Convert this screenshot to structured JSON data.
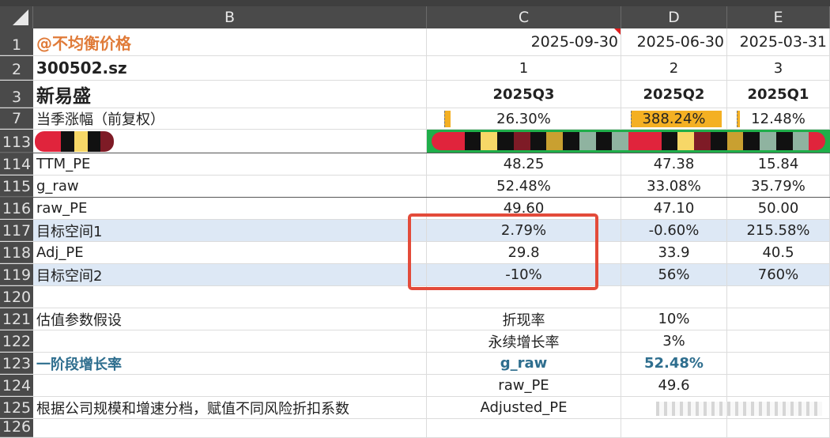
{
  "columns": {
    "b": "B",
    "c": "C",
    "d": "D",
    "e": "E"
  },
  "rows": [
    {
      "num": "1",
      "b": "@不均衡价格",
      "c": "2025-09-30",
      "d": "2025-06-30",
      "e": "2025-03-31"
    },
    {
      "num": "2",
      "b": "300502.sz",
      "c": "1",
      "d": "2",
      "e": "3"
    },
    {
      "num": "3",
      "b": "新易盛",
      "c": "2025Q3",
      "d": "2025Q2",
      "e": "2025Q1"
    },
    {
      "num": "7",
      "b": "当季涨幅（前复权）",
      "c": "26.30%",
      "d": "388.24%",
      "e": "12.48%"
    },
    {
      "num": "113"
    },
    {
      "num": "114",
      "b": "TTM_PE",
      "c": "48.25",
      "d": "47.38",
      "e": "15.84"
    },
    {
      "num": "115",
      "b": "g_raw",
      "c": "52.48%",
      "d": "33.08%",
      "e": "35.79%"
    },
    {
      "num": "116",
      "b": "raw_PE",
      "c": "49.60",
      "d": "47.10",
      "e": "50.00"
    },
    {
      "num": "117",
      "b": "目标空间1",
      "c": "2.79%",
      "d": "-0.60%",
      "e": "215.58%"
    },
    {
      "num": "118",
      "b": "Adj_PE",
      "c": "29.8",
      "d": "33.9",
      "e": "40.5"
    },
    {
      "num": "119",
      "b": "目标空间2",
      "c": "-10%",
      "d": "56%",
      "e": "760%"
    },
    {
      "num": "120"
    },
    {
      "num": "121",
      "b": "估值参数假设",
      "c": "折现率",
      "d": "10%"
    },
    {
      "num": "122",
      "c": "永续增长率",
      "d": "3%"
    },
    {
      "num": "123",
      "b": "一阶段增长率",
      "c": "g_raw",
      "d": "52.48%"
    },
    {
      "num": "124",
      "c": "raw_PE",
      "d": "49.6"
    },
    {
      "num": "125",
      "b": "根据公司规模和增速分档，赋值不同风险折扣系数",
      "c": "Adjusted_PE"
    },
    {
      "num": "126"
    }
  ],
  "colors": {
    "accent_orange": "#e07b39",
    "blue_text": "#2e6e8e",
    "highlight": "#dde8f5",
    "bar": "#f4b023",
    "annotation": "#e34b3a"
  },
  "bars": {
    "c": 0.068,
    "d": 1.0,
    "e": 0.032
  }
}
